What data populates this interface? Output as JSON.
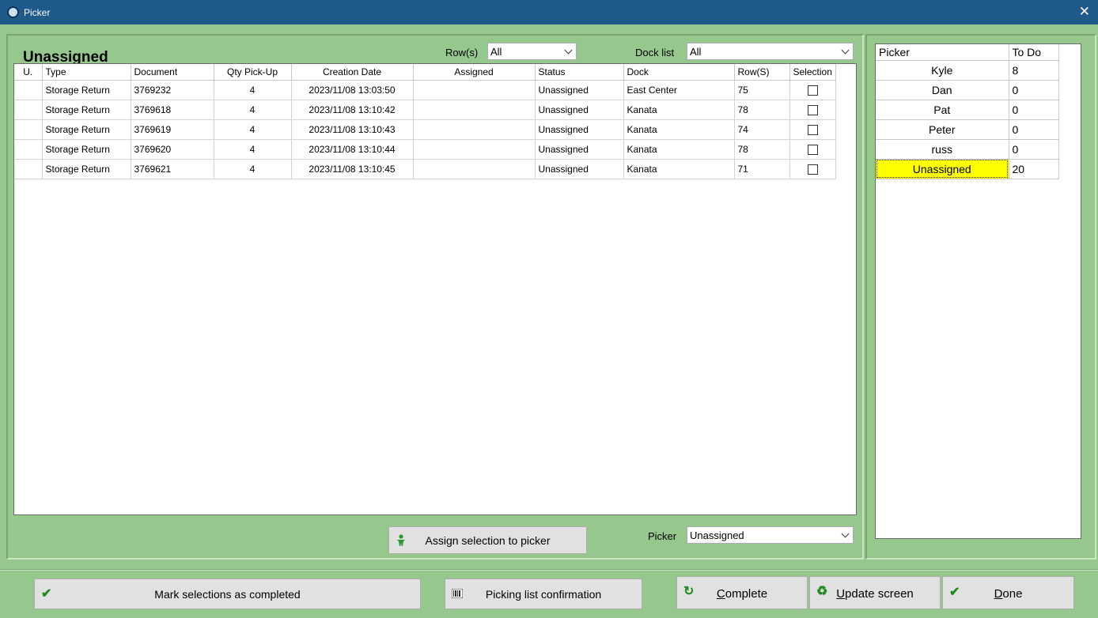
{
  "window": {
    "title": "Picker",
    "close_glyph": "✕"
  },
  "heading": "Unassigned",
  "filters": {
    "rows_label": "Row(s)",
    "rows_value": "All",
    "dock_label": "Dock list",
    "dock_value": "All"
  },
  "grid": {
    "columns": [
      "U.",
      "Type",
      "Document",
      "Qty Pick-Up",
      "Creation Date",
      "Assigned",
      "Status",
      "Dock",
      "Row(S)",
      "Selection"
    ],
    "rows": [
      {
        "u": "",
        "type": "Storage Return",
        "document": "3769232",
        "qty": "4",
        "date": "2023/11/08 13:03:50",
        "assigned": "",
        "status": "Unassigned",
        "dock": "East Center",
        "row": "75",
        "selected": false
      },
      {
        "u": "",
        "type": "Storage Return",
        "document": "3769618",
        "qty": "4",
        "date": "2023/11/08 13:10:42",
        "assigned": "",
        "status": "Unassigned",
        "dock": "Kanata",
        "row": "78",
        "selected": false
      },
      {
        "u": "",
        "type": "Storage Return",
        "document": "3769619",
        "qty": "4",
        "date": "2023/11/08 13:10:43",
        "assigned": "",
        "status": "Unassigned",
        "dock": "Kanata",
        "row": "74",
        "selected": false
      },
      {
        "u": "",
        "type": "Storage Return",
        "document": "3769620",
        "qty": "4",
        "date": "2023/11/08 13:10:44",
        "assigned": "",
        "status": "Unassigned",
        "dock": "Kanata",
        "row": "78",
        "selected": false
      },
      {
        "u": "",
        "type": "Storage Return",
        "document": "3769621",
        "qty": "4",
        "date": "2023/11/08 13:10:45",
        "assigned": "",
        "status": "Unassigned",
        "dock": "Kanata",
        "row": "71",
        "selected": false
      }
    ]
  },
  "pickers": {
    "columns": [
      "Picker",
      "To Do"
    ],
    "rows": [
      {
        "name": "Kyle",
        "todo": "8"
      },
      {
        "name": "Dan",
        "todo": "0"
      },
      {
        "name": "Pat",
        "todo": "0"
      },
      {
        "name": "Peter",
        "todo": "0"
      },
      {
        "name": "russ",
        "todo": "0"
      },
      {
        "name": "Unassigned",
        "todo": "20",
        "highlighted": true
      }
    ],
    "highlight_color": "#ffff00"
  },
  "assign": {
    "button_label": "Assign selection to picker",
    "button_icon": "person-icon",
    "picker_label": "Picker",
    "picker_value": "Unassigned"
  },
  "footer": {
    "mark_completed": {
      "label": "Mark selections as completed",
      "icon": "checkmark-icon"
    },
    "picking_list": {
      "label": "Picking list confirmation",
      "icon": "barcode-icon"
    },
    "complete": {
      "mnemonic": "C",
      "rest": "omplete",
      "icon": "undo-arrow-icon"
    },
    "update": {
      "mnemonic": "U",
      "rest": "pdate screen",
      "icon": "recycle-icon"
    },
    "done": {
      "mnemonic": "D",
      "rest": "one",
      "icon": "checkmark-icon"
    }
  },
  "colors": {
    "background": "#96c78c",
    "titlebar": "#1f5a8a",
    "button": "#e1e1e1"
  }
}
